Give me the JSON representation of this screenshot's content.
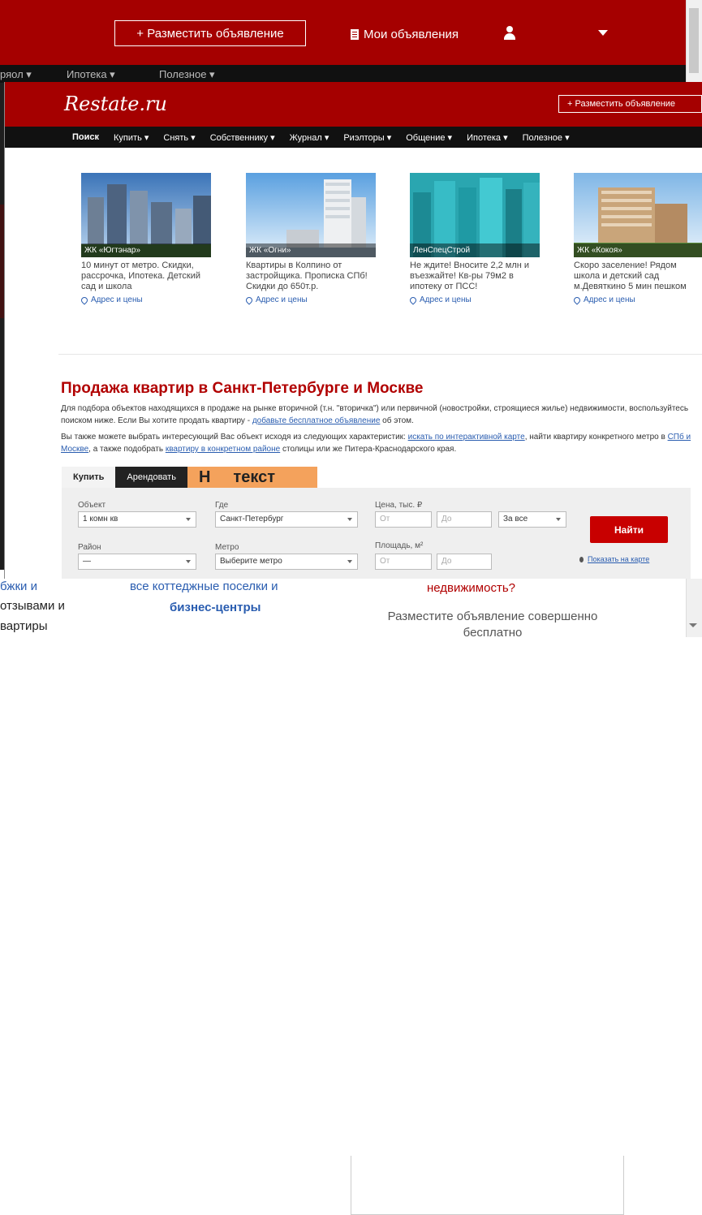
{
  "background": {
    "header": {
      "post_ad_button": "+ Разместить объявление",
      "my_ads": "Мои объявления"
    },
    "subnav_items": [
      "ряол ▾",
      "Ипотека ▾",
      "Полезное ▾"
    ],
    "bottom": {
      "left_text_1": "бжки и",
      "left_text_2": "отзывами и",
      "left_text_3": "вартиры",
      "center_link_1": "все коттеджные поселки и",
      "center_link_2": "бизнес-центры",
      "right_heading": "недвижимость?",
      "right_text": "Разместите объявление совершенно бесплатно"
    }
  },
  "site": {
    "logo": "Restate.ru",
    "post_ad_button": "+ Разместить объявление",
    "nav": [
      {
        "label": "Поиск",
        "active": true
      },
      {
        "label": "Купить ▾"
      },
      {
        "label": "Снять ▾"
      },
      {
        "label": "Собственнику ▾"
      },
      {
        "label": "Журнал ▾"
      },
      {
        "label": "Риэлторы ▾"
      },
      {
        "label": "Общение ▾"
      },
      {
        "label": "Ипотека ▾"
      },
      {
        "label": "Полезное ▾"
      }
    ],
    "promos": [
      {
        "caption": "ЖК «Югтэнар»",
        "text": "10 минут от метро. Скидки, рассрочка, Ипотека. Детский сад и школа",
        "link": "Адрес и цены"
      },
      {
        "caption": "ЖК «Огни»",
        "text": "Квартиры в Колпино от застройщика. Прописка СПб! Скидки до 650т.р.",
        "link": "Адрес и цены"
      },
      {
        "caption": "ЛенСпецСтрой",
        "text": "Не ждите! Вносите 2,2 млн и въезжайте! Кв-ры 79м2 в ипотеку от ПСС!",
        "link": "Адрес и цены"
      },
      {
        "caption": "ЖК «Кокоя»",
        "text": "Скоро заселение! Рядом школа и детский сад м.Девяткино 5 мин пешком",
        "link": "Адрес и цены"
      }
    ],
    "section": {
      "title": "Продажа квартир в Санкт-Петербурге и Москве",
      "p1_before": "Для подбора объектов находящихся в продаже на рынке вторичной (т.н. \"вторичка\") или первичной (новостройки, строящиеся жилье) недвижимости, воспользуйтесь поиском ниже. Если Вы хотите продать квартиру - ",
      "p1_link": "добавьте бесплатное объявление",
      "p1_after": " об этом.",
      "p2_a": "Вы также можете выбрать интересующий Вас объект исходя из следующих характеристик: ",
      "p2_link1": "искать по интерактивной карте",
      "p2_b": ", найти квартиру конкретного метро в ",
      "p2_link2": "СПб и Москве",
      "p2_c": ", а также подобрать ",
      "p2_link3": "квартиру в конкретном районе",
      "p2_d": " столицы или же Питера-Краснодарского края."
    },
    "search": {
      "tabs": [
        "Купить",
        "Арендовать"
      ],
      "overlay_text_1": "Н",
      "overlay_text_2": "текст",
      "object_label": "Объект",
      "object_value": "1 комн кв",
      "where_label": "Где",
      "where_value": "Санкт-Петербург",
      "price_label": "Цена, тыс. ₽",
      "price_from": "От",
      "price_to": "До",
      "price_for": "За все",
      "district_label": "Район",
      "district_value": "—",
      "metro_label": "Метро",
      "metro_value": "Выберите метро",
      "area_label": "Площадь, м²",
      "area_from": "От",
      "area_to": "До",
      "find_button": "Найти",
      "map_link": "Показать на карте"
    }
  },
  "colors": {
    "brand_red": "#a50000",
    "nav_black": "#111111",
    "link_blue": "#2a5db0",
    "button_red": "#c80000",
    "overlay_orange": "#f4a25c"
  }
}
